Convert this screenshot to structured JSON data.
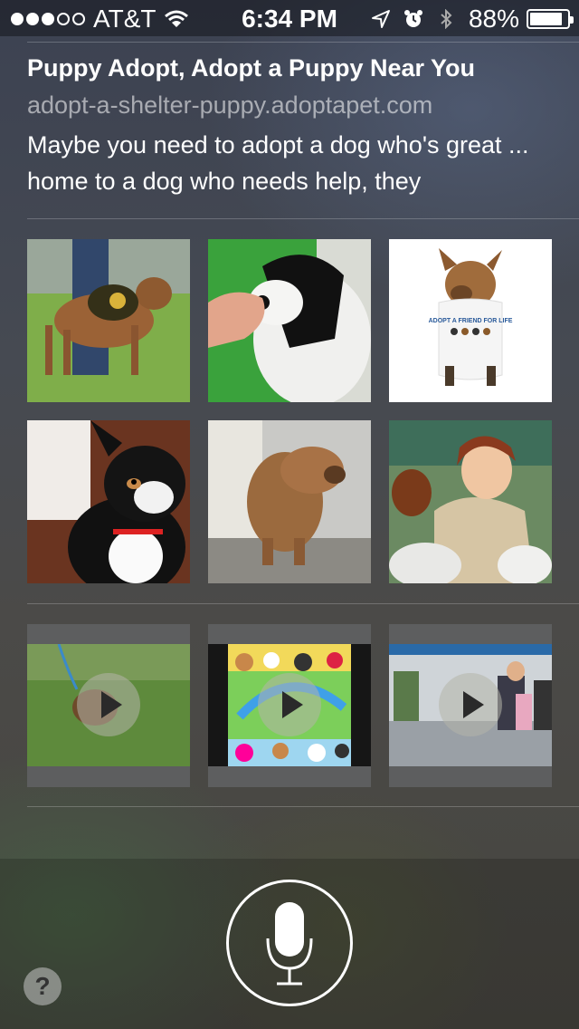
{
  "status_bar": {
    "signal_dots": [
      true,
      true,
      true,
      false,
      false
    ],
    "carrier": "AT&T",
    "time": "6:34 PM",
    "battery_percent": "88%",
    "battery_level": 0.88,
    "icons": [
      "wifi-icon",
      "location-arrow-icon",
      "alarm-icon",
      "bluetooth-icon",
      "battery-icon"
    ]
  },
  "result": {
    "title": "Puppy Adopt, Adopt a Puppy Near You",
    "url": "adopt-a-shelter-puppy.adoptapet.com",
    "snippet": "Maybe you need to adopt a dog who's great ... home to a dog who needs help, they"
  },
  "images": [
    {
      "name": "image-dog-vest-on-grass",
      "shirt_text": ""
    },
    {
      "name": "image-border-collie-hand",
      "shirt_text": ""
    },
    {
      "name": "image-dog-in-tshirt",
      "shirt_text": "ADOPT A FRIEND FOR LIFE"
    },
    {
      "name": "image-tricolor-dog",
      "shirt_text": ""
    },
    {
      "name": "image-brown-dog-sitting",
      "shirt_text": ""
    },
    {
      "name": "image-woman-with-dogs",
      "shirt_text": ""
    }
  ],
  "videos": [
    {
      "name": "video-puppy-on-grass"
    },
    {
      "name": "video-cartoon-dogs"
    },
    {
      "name": "video-shelter-visitors"
    }
  ],
  "controls": {
    "help_label": "?",
    "mic_icon": "microphone-icon"
  },
  "colors": {
    "accent": "#ffffff",
    "url_gray": "#a9abb1"
  }
}
